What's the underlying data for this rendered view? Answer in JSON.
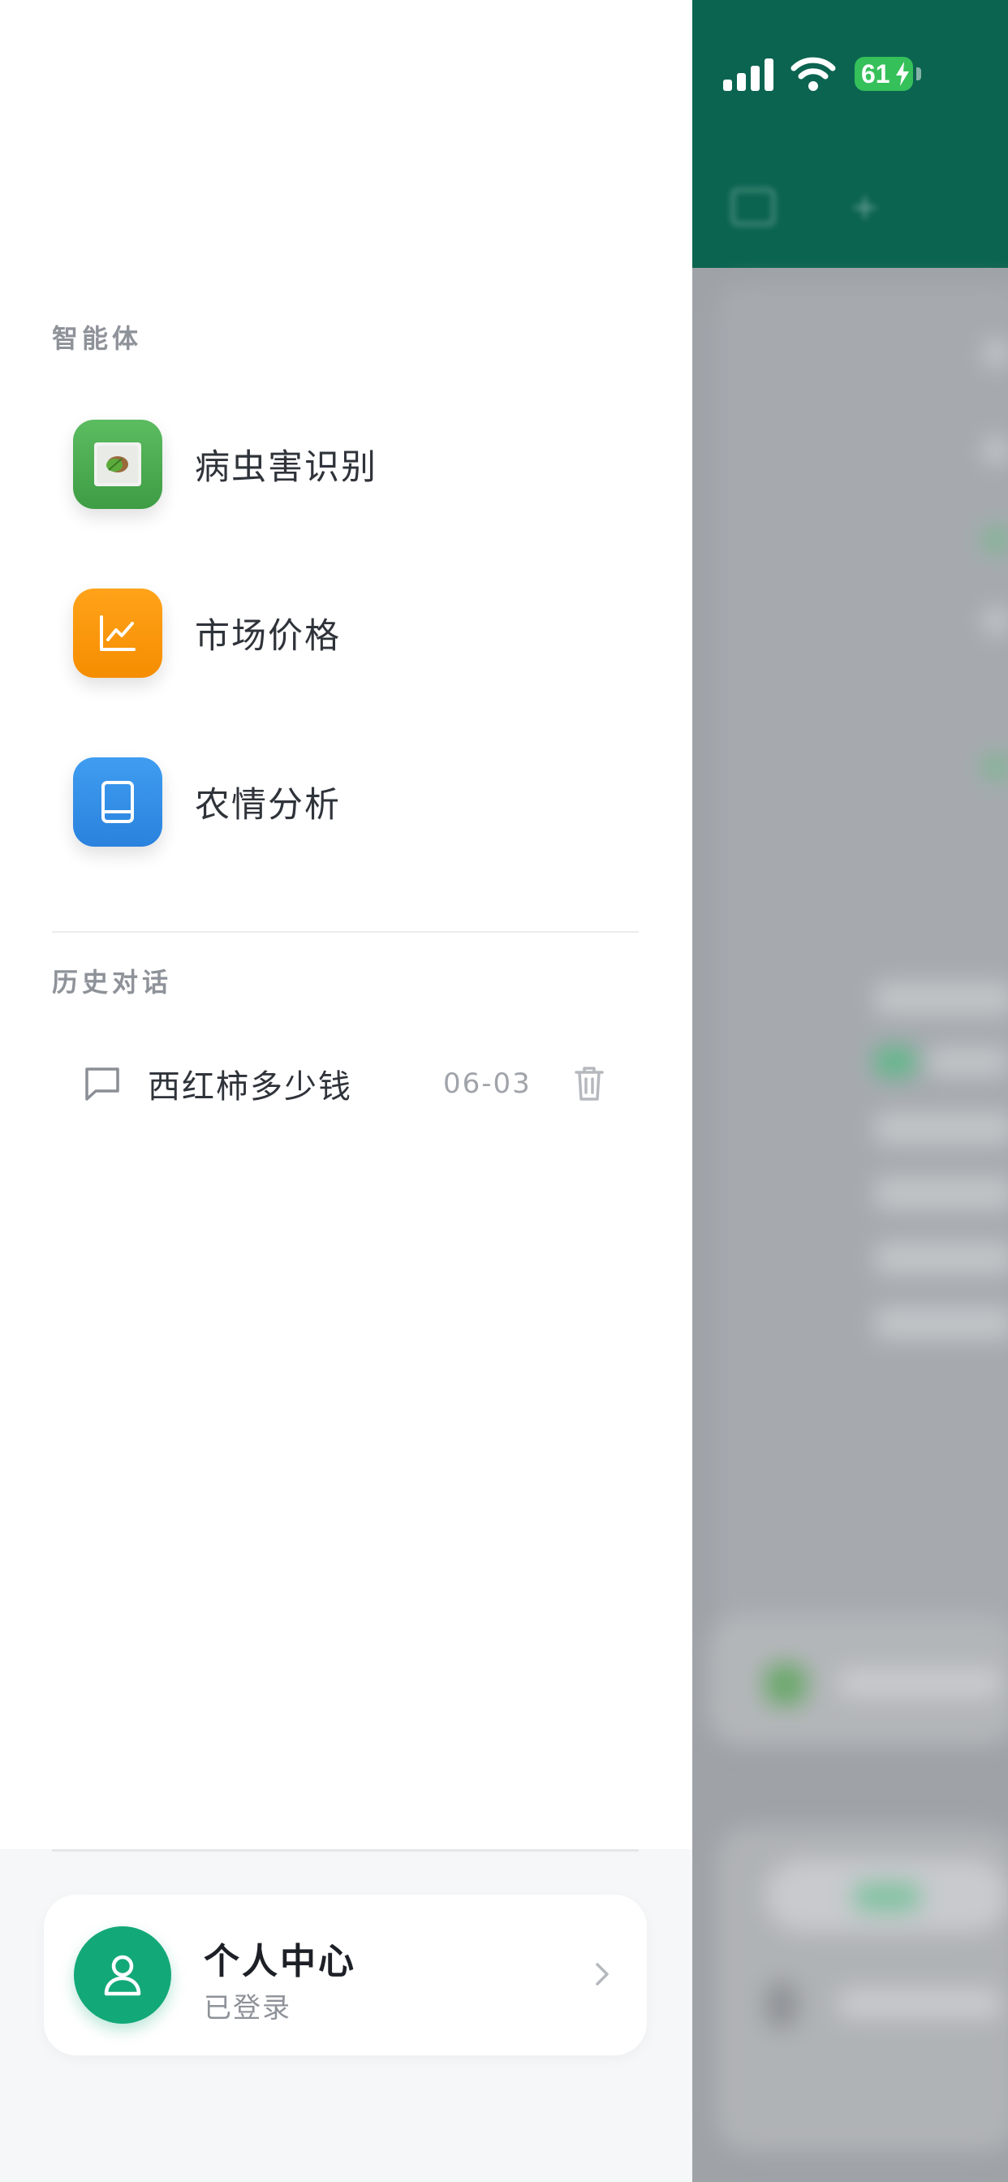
{
  "status_bar": {
    "battery_level": "61",
    "signal": "signal-icon",
    "wifi": "wifi-icon",
    "charging": "bolt-icon"
  },
  "drawer": {
    "agents_section_label": "智能体",
    "agents": [
      {
        "label": "病虫害识别",
        "icon": "leaf-photo-icon",
        "color": "#4caf50"
      },
      {
        "label": "市场价格",
        "icon": "line-chart-icon",
        "color": "#ff9800"
      },
      {
        "label": "农情分析",
        "icon": "book-icon",
        "color": "#2e8ee8"
      }
    ],
    "history_section_label": "历史对话",
    "history": [
      {
        "title": "西红柿多少钱",
        "date": "06-03",
        "icon": "chat-bubble-icon",
        "delete_icon": "trash-icon"
      }
    ],
    "profile": {
      "name": "个人中心",
      "status": "已登录",
      "icon": "user-icon",
      "accent": "#13a878"
    }
  },
  "background": {
    "header_color": "#0b6450"
  }
}
